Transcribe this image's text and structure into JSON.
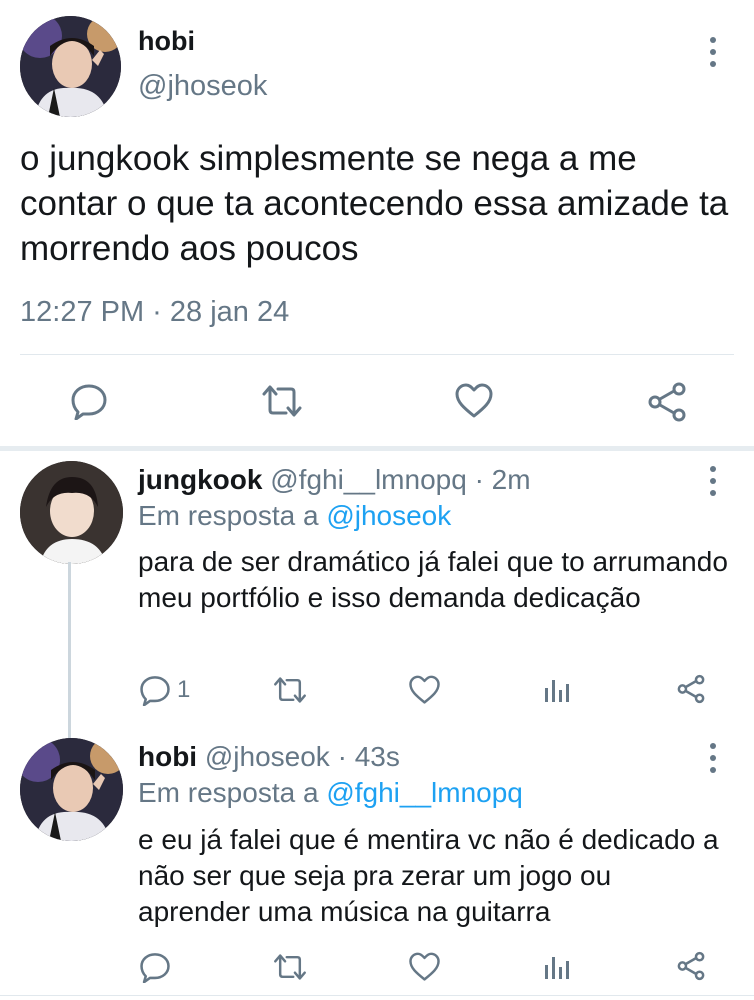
{
  "main_tweet": {
    "display_name": "hobi",
    "handle": "@jhoseok",
    "text": "o jungkook simplesmente se nega a me contar o que ta acontecendo essa amizade ta morrendo aos poucos",
    "timestamp": "12:27 PM · 28 jan 24"
  },
  "replies": [
    {
      "display_name": "jungkook",
      "handle": "@fghi__lmnopq",
      "time": "· 2m",
      "reply_prefix": "Em resposta a",
      "reply_to": "@jhoseok",
      "text": "para de ser dramático já falei que to arrumando meu portfólio e isso demanda dedicação",
      "reply_count": "1"
    },
    {
      "display_name": "hobi",
      "handle": "@jhoseok",
      "time": "· 43s",
      "reply_prefix": "Em resposta a",
      "reply_to": "@fghi__lmnopq",
      "text": "e eu já falei que é mentira vc não é dedicado a não ser que seja pra zerar um jogo ou aprender uma música na guitarra",
      "reply_count": ""
    }
  ],
  "icons": {
    "reply": "reply-icon",
    "retweet": "retweet-icon",
    "like": "heart-icon",
    "analytics": "analytics-icon",
    "share": "share-icon",
    "more": "more-options-icon"
  },
  "colors": {
    "text": "#14171a",
    "secondary": "#657786",
    "link": "#1da1f2",
    "divider": "#e1e8ed"
  }
}
